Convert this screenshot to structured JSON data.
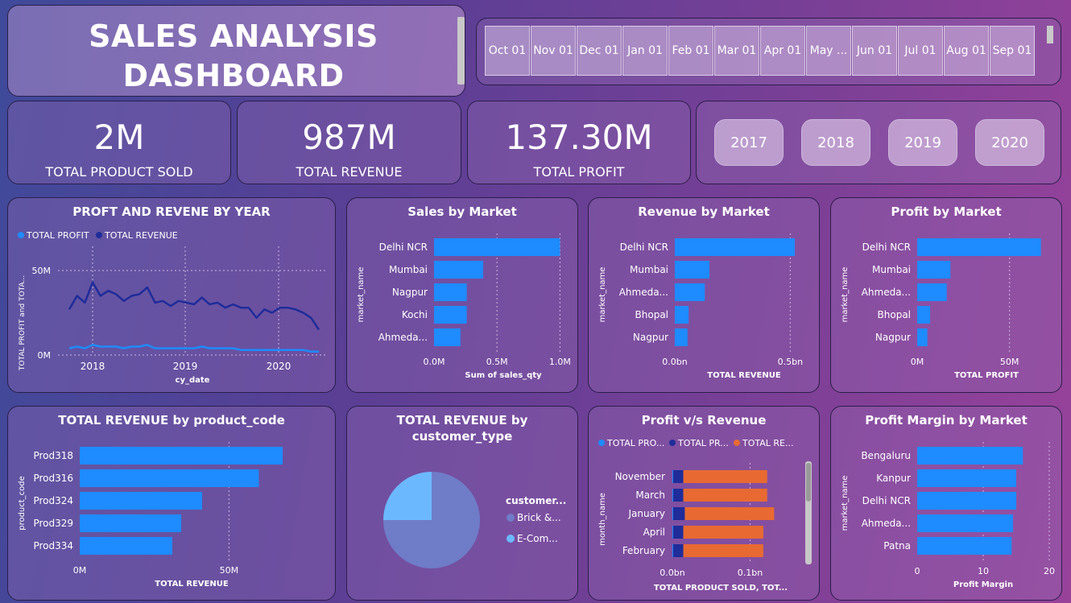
{
  "title": {
    "line1": "SALES ANALYSIS",
    "line2": "DASHBOARD"
  },
  "months": [
    "Oct 01",
    "Nov 01",
    "Dec 01",
    "Jan 01",
    "Feb 01",
    "Mar 01",
    "Apr 01",
    "May ...",
    "Jun 01",
    "Jul 01",
    "Aug 01",
    "Sep 01"
  ],
  "kpis": {
    "sold": {
      "value": "2M",
      "label": "TOTAL PRODUCT SOLD"
    },
    "revenue": {
      "value": "987M",
      "label": "TOTAL REVENUE"
    },
    "profit": {
      "value": "137.30M",
      "label": "TOTAL PROFIT"
    }
  },
  "years": [
    "2017",
    "2018",
    "2019",
    "2020"
  ],
  "colors": {
    "bar": "#1e8bff",
    "dark": "#1f2c9a",
    "orange": "#e86a32",
    "pie_main": "#6f7cc8",
    "pie_light": "#6cb8ff"
  },
  "charts": {
    "line": {
      "title": "PROFT AND REVENE BY YEAR",
      "legend": [
        "TOTAL PROFIT",
        "TOTAL REVENUE"
      ],
      "ylabel": "TOTAL PROFIT and TOTA...",
      "xlabel": "cy_date",
      "yticks": [
        "50M",
        "0M"
      ],
      "xticks": [
        "2018",
        "2019",
        "2020"
      ]
    },
    "sales_market": {
      "title": "Sales by Market",
      "ylabel": "market_name",
      "xlabel": "Sum of sales_qty",
      "xticks": [
        "0.0M",
        "0.5M",
        "1.0M"
      ]
    },
    "revenue_market": {
      "title": "Revenue by Market",
      "ylabel": "market_name",
      "xlabel": "TOTAL REVENUE",
      "xticks": [
        "0.0bn",
        "0.5bn"
      ]
    },
    "profit_market": {
      "title": "Profit by Market",
      "ylabel": "market_name",
      "xlabel": "TOTAL PROFIT",
      "xticks": [
        "0M",
        "50M"
      ]
    },
    "product": {
      "title": "TOTAL REVENUE by product_code",
      "ylabel": "product_code",
      "xlabel": "TOTAL REVENUE",
      "xticks": [
        "0M",
        "50M"
      ]
    },
    "pie": {
      "title1": "TOTAL REVENUE by",
      "title2": "customer_type",
      "legend_title": "customer...",
      "legend": [
        "Brick &...",
        "E-Com..."
      ]
    },
    "pvr": {
      "title": "Profit v/s Revenue",
      "legend": [
        "TOTAL PRO...",
        "TOTAL PR...",
        "TOTAL RE..."
      ],
      "ylabel": "month_name",
      "xlabel": "TOTAL PRODUCT SOLD, TOT...",
      "xticks": [
        "0.0bn",
        "0.1bn"
      ]
    },
    "margin": {
      "title": "Profit Margin by Market",
      "ylabel": "market_name",
      "xlabel": "Profit Margin",
      "xticks": [
        "0",
        "10",
        "20"
      ]
    }
  },
  "chart_data": [
    {
      "type": "line",
      "title": "PROFT AND REVENE BY YEAR",
      "xlabel": "cy_date",
      "ylabel": "TOTAL PROFIT and TOTA...",
      "ylim": [
        0,
        60
      ],
      "x": [
        "2017-10",
        "2017-11",
        "2017-12",
        "2018-01",
        "2018-02",
        "2018-03",
        "2018-04",
        "2018-05",
        "2018-06",
        "2018-07",
        "2018-08",
        "2018-09",
        "2018-10",
        "2018-11",
        "2018-12",
        "2019-01",
        "2019-02",
        "2019-03",
        "2019-04",
        "2019-05",
        "2019-06",
        "2019-07",
        "2019-08",
        "2019-09",
        "2019-10",
        "2019-11",
        "2019-12",
        "2020-01",
        "2020-02",
        "2020-03",
        "2020-04",
        "2020-05",
        "2020-06"
      ],
      "series": [
        {
          "name": "TOTAL REVENUE",
          "values": [
            27,
            35,
            31,
            43,
            35,
            38,
            36,
            32,
            35,
            36,
            40,
            31,
            32,
            29,
            32,
            31,
            30,
            34,
            30,
            31,
            28,
            30,
            28,
            28,
            22,
            27,
            25,
            28,
            28,
            27,
            25,
            22,
            15
          ]
        },
        {
          "name": "TOTAL PROFIT",
          "values": [
            4,
            5,
            4,
            6,
            5,
            5,
            5,
            4,
            5,
            5,
            6,
            4,
            4,
            4,
            4,
            4,
            4,
            5,
            4,
            4,
            4,
            4,
            3,
            3,
            3,
            3,
            3,
            3,
            3,
            3,
            3,
            2,
            2
          ]
        }
      ]
    },
    {
      "type": "bar",
      "title": "Sales by Market",
      "categories": [
        "Delhi NCR",
        "Mumbai",
        "Nagpur",
        "Kochi",
        "Ahmeda..."
      ],
      "values": [
        1.0,
        0.39,
        0.26,
        0.26,
        0.21
      ],
      "xlim": [
        0,
        1.1
      ]
    },
    {
      "type": "bar",
      "title": "Revenue by Market",
      "categories": [
        "Delhi NCR",
        "Mumbai",
        "Ahmeda...",
        "Bhopal",
        "Nagpur"
      ],
      "values": [
        0.52,
        0.15,
        0.13,
        0.06,
        0.055
      ],
      "xlim": [
        0,
        0.6
      ]
    },
    {
      "type": "bar",
      "title": "Profit by Market",
      "categories": [
        "Delhi NCR",
        "Mumbai",
        "Ahmeda...",
        "Bhopal",
        "Nagpur"
      ],
      "values": [
        67,
        18,
        16,
        7,
        5.5
      ],
      "xlim": [
        0,
        75
      ]
    },
    {
      "type": "bar",
      "title": "TOTAL REVENUE by product_code",
      "categories": [
        "Prod318",
        "Prod316",
        "Prod324",
        "Prod329",
        "Prod334"
      ],
      "values": [
        68,
        60,
        41,
        34,
        31
      ],
      "xlim": [
        0,
        75
      ]
    },
    {
      "type": "pie",
      "title": "TOTAL REVENUE by customer_type",
      "categories": [
        "Brick &...",
        "E-Com..."
      ],
      "values": [
        75,
        25
      ]
    },
    {
      "type": "bar",
      "title": "Profit v/s Revenue",
      "categories": [
        "November",
        "March",
        "January",
        "April",
        "February"
      ],
      "series": [
        {
          "name": "TOTAL PRO...",
          "values": [
            0.001,
            0.001,
            0.001,
            0.001,
            0.001
          ]
        },
        {
          "name": "TOTAL PR...",
          "values": [
            0.013,
            0.013,
            0.015,
            0.013,
            0.013
          ]
        },
        {
          "name": "TOTAL RE...",
          "values": [
            0.108,
            0.108,
            0.115,
            0.103,
            0.103
          ]
        }
      ],
      "xlim": [
        0,
        0.17
      ]
    },
    {
      "type": "bar",
      "title": "Profit Margin by Market",
      "categories": [
        "Bengaluru",
        "Kanpur",
        "Delhi NCR",
        "Ahmeda...",
        "Patna"
      ],
      "values": [
        16,
        15,
        15,
        14.5,
        14.3
      ],
      "xlim": [
        0,
        20
      ]
    }
  ]
}
